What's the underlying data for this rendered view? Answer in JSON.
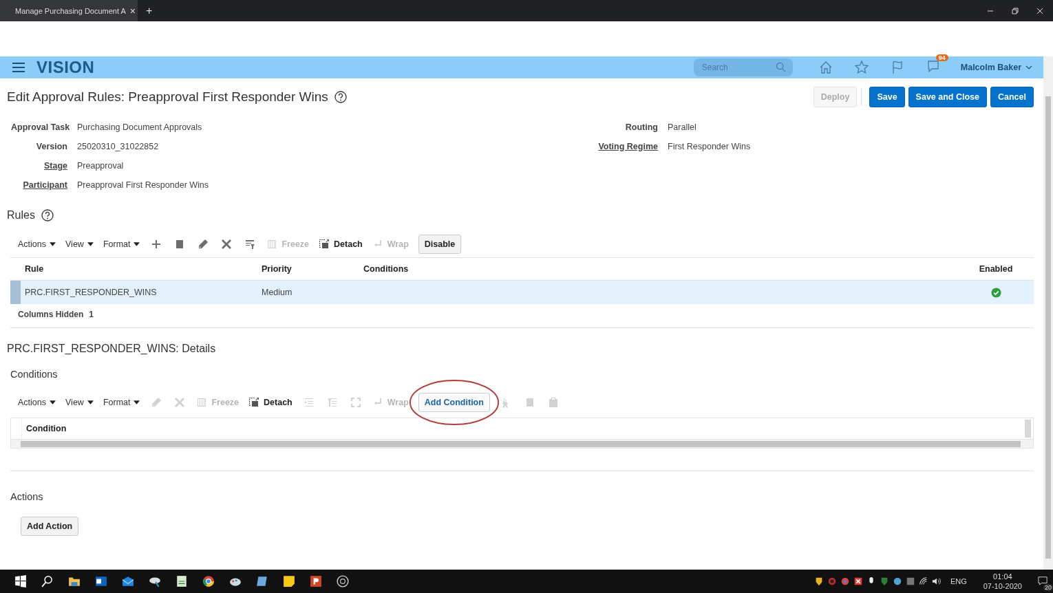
{
  "browser": {
    "tab_title": "Manage Purchasing Document A",
    "close": "×",
    "new_tab": "+"
  },
  "header": {
    "brand": "VISION",
    "search": {
      "placeholder": "Search"
    },
    "notification_count": "94",
    "user": "Malcolm Baker"
  },
  "page": {
    "title": "Edit Approval Rules: Preapproval First Responder Wins",
    "buttons": [
      {
        "label": "Deploy",
        "kind": "secondary",
        "disabled": true
      },
      {
        "label": "Save",
        "kind": "primary",
        "disabled": false
      },
      {
        "label": "Save and Close",
        "kind": "primary",
        "disabled": false
      },
      {
        "label": "Cancel",
        "kind": "primary",
        "disabled": false
      }
    ]
  },
  "fields_left": [
    {
      "label": "Approval Task",
      "value": "Purchasing Document Approvals",
      "link": false
    },
    {
      "label": "Version",
      "value": "25020310_31022852",
      "link": false
    },
    {
      "label": "Stage",
      "value": "Preapproval",
      "link": true
    },
    {
      "label": "Participant",
      "value": "Preapproval First Responder Wins",
      "link": true
    }
  ],
  "fields_right": [
    {
      "label": "Routing",
      "value": "Parallel",
      "link": false
    },
    {
      "label": "Voting Regime",
      "value": "First Responder Wins",
      "link": true
    }
  ],
  "rules": {
    "title": "Rules",
    "toolbar": [
      {
        "kind": "menu",
        "label": "Actions"
      },
      {
        "kind": "menu",
        "label": "View"
      },
      {
        "kind": "menu",
        "label": "Format"
      },
      {
        "kind": "icon",
        "disabled": false
      },
      {
        "kind": "icon",
        "disabled": false
      },
      {
        "kind": "icon",
        "disabled": false
      },
      {
        "kind": "icon",
        "disabled": false
      },
      {
        "kind": "icon",
        "disabled": false
      },
      {
        "kind": "tool",
        "label": "Freeze",
        "disabled": true
      },
      {
        "kind": "tool",
        "label": "Detach",
        "disabled": false
      },
      {
        "kind": "tool",
        "label": "Wrap",
        "disabled": true
      },
      {
        "kind": "button",
        "label": "Disable"
      }
    ],
    "columns": [
      "Rule",
      "Priority",
      "Conditions",
      "Enabled"
    ],
    "rows": [
      {
        "rule": "PRC.FIRST_RESPONDER_WINS",
        "priority": "Medium",
        "enabled": true,
        "selected": true
      }
    ],
    "columns_hidden_label": "Columns Hidden",
    "columns_hidden": "1"
  },
  "details_title": "PRC.FIRST_RESPONDER_WINS: Details",
  "conditions": {
    "title": "Conditions",
    "toolbar": [
      {
        "kind": "menu",
        "label": "Actions"
      },
      {
        "kind": "menu",
        "label": "View"
      },
      {
        "kind": "menu",
        "label": "Format"
      },
      {
        "kind": "icon",
        "disabled": true
      },
      {
        "kind": "icon",
        "disabled": true
      },
      {
        "kind": "tool",
        "label": "Freeze",
        "disabled": true
      },
      {
        "kind": "tool",
        "label": "Detach",
        "disabled": false
      },
      {
        "kind": "icon",
        "disabled": true
      },
      {
        "kind": "icon",
        "disabled": true
      },
      {
        "kind": "icon",
        "disabled": true
      },
      {
        "kind": "tool",
        "label": "Wrap",
        "disabled": true
      },
      {
        "kind": "button",
        "label": "Add Condition",
        "annotated": true
      },
      {
        "kind": "icon",
        "disabled": true
      },
      {
        "kind": "icon",
        "disabled": true
      },
      {
        "kind": "icon",
        "disabled": true
      }
    ],
    "columns": [
      "Condition"
    ]
  },
  "actions": {
    "title": "Actions",
    "button": "Add Action"
  },
  "taskbar": {
    "language": "ENG",
    "time": "01:04",
    "date": "07-10-2020",
    "notifications": "20"
  }
}
